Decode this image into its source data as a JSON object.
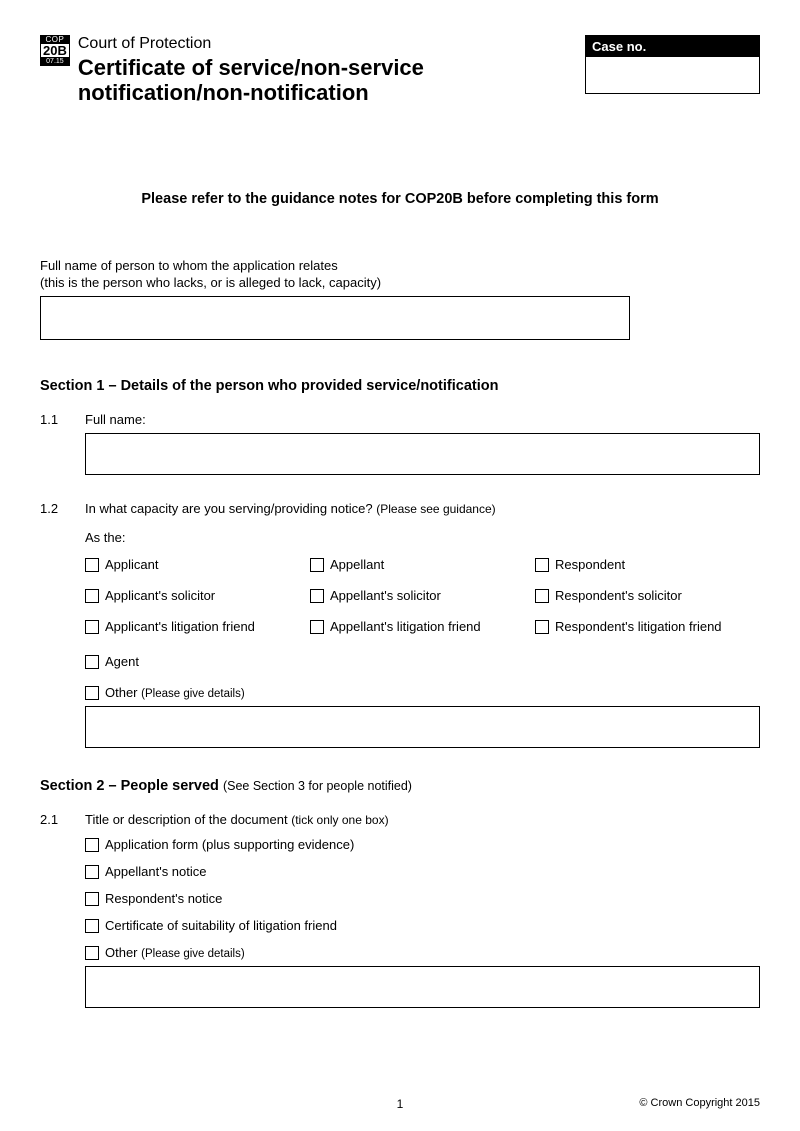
{
  "badge": {
    "top": "COP",
    "mid": "20B",
    "bot": "07.15"
  },
  "header": {
    "overline": "Court of Protection",
    "title_line1": "Certificate of service/non-service",
    "title_line2": "notification/non-notification",
    "case_no_label": "Case no."
  },
  "instruction": "Please refer to the guidance notes for COP20B before completing this form",
  "fullname_field": {
    "line1": "Full name of person to whom the application relates",
    "line2": "(this is the person who lacks, or is alleged to lack, capacity)"
  },
  "section1": {
    "heading": "Section 1 – Details of the person who provided service/notification",
    "q1": {
      "num": "1.1",
      "label": "Full name:"
    },
    "q2": {
      "num": "1.2",
      "label": "In what capacity are you serving/providing notice?",
      "hint": "(Please see guidance)",
      "as_the": "As the:",
      "options": {
        "col1": [
          "Applicant",
          "Applicant's solicitor",
          "Applicant's litigation friend"
        ],
        "col2": [
          "Appellant",
          "Appellant's solicitor",
          "Appellant's litigation friend"
        ],
        "col3": [
          "Respondent",
          "Respondent's solicitor",
          "Respondent's litigation friend"
        ]
      },
      "agent": "Agent",
      "other": "Other",
      "other_hint": "(Please give details)"
    }
  },
  "section2": {
    "heading": "Section 2 – People served",
    "heading_hint": "(See Section 3 for people notified)",
    "q1": {
      "num": "2.1",
      "label": "Title or description of the document",
      "hint": "(tick only one box)",
      "options": [
        "Application form (plus supporting evidence)",
        "Appellant's notice",
        "Respondent's notice",
        "Certificate of suitability of litigation friend"
      ],
      "other": "Other",
      "other_hint": "(Please give details)"
    }
  },
  "footer": {
    "page": "1",
    "copyright": "© Crown Copyright 2015"
  }
}
